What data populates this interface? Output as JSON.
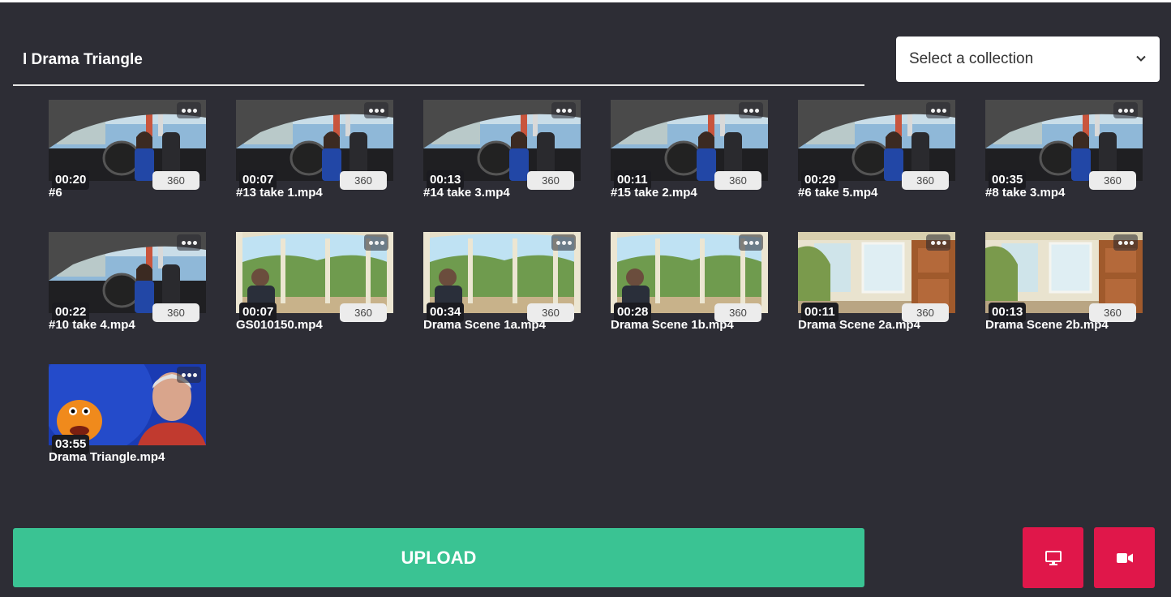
{
  "search": {
    "value": "l Drama Triangle"
  },
  "collection_select": {
    "selected": "Select a collection"
  },
  "videos": [
    {
      "duration": "00:20",
      "resolution": "360",
      "filename": "#6",
      "thumb": "car"
    },
    {
      "duration": "00:07",
      "resolution": "360",
      "filename": "#13 take 1.mp4",
      "thumb": "car"
    },
    {
      "duration": "00:13",
      "resolution": "360",
      "filename": "#14 take 3.mp4",
      "thumb": "car"
    },
    {
      "duration": "00:11",
      "resolution": "360",
      "filename": "#15 take 2.mp4",
      "thumb": "car"
    },
    {
      "duration": "00:29",
      "resolution": "360",
      "filename": "#6 take 5.mp4",
      "thumb": "car"
    },
    {
      "duration": "00:35",
      "resolution": "360",
      "filename": "#8 take 3.mp4",
      "thumb": "car"
    },
    {
      "duration": "00:22",
      "resolution": "360",
      "filename": "#10 take 4.mp4",
      "thumb": "car"
    },
    {
      "duration": "00:07",
      "resolution": "360",
      "filename": "GS010150.mp4",
      "thumb": "porch"
    },
    {
      "duration": "00:34",
      "resolution": "360",
      "filename": "Drama Scene 1a.mp4",
      "thumb": "porch"
    },
    {
      "duration": "00:28",
      "resolution": "360",
      "filename": "Drama Scene 1b.mp4",
      "thumb": "porch"
    },
    {
      "duration": "00:11",
      "resolution": "360",
      "filename": "Drama Scene 2a.mp4",
      "thumb": "room"
    },
    {
      "duration": "00:13",
      "resolution": "360",
      "filename": "Drama Scene 2b.mp4",
      "thumb": "room"
    },
    {
      "duration": "03:55",
      "resolution": "",
      "filename": "Drama Triangle.mp4",
      "thumb": "puppet"
    }
  ],
  "upload_label": "UPLOAD",
  "icons": {
    "screen_button": "monitor-icon",
    "camera_button": "video-camera-icon"
  },
  "colors": {
    "background": "#2d2d35",
    "upload": "#3ac393",
    "action_red": "#e0174a"
  }
}
